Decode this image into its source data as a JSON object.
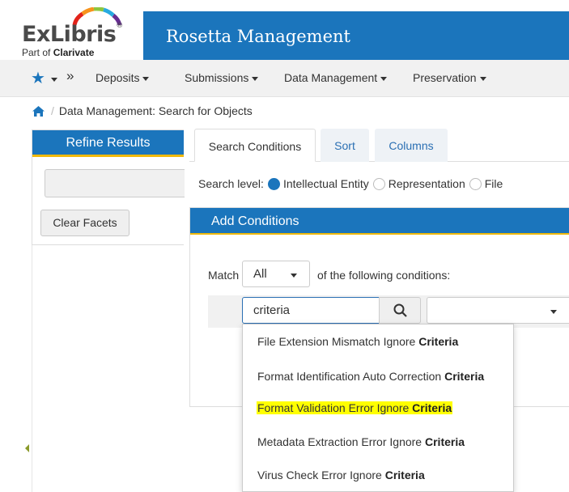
{
  "header": {
    "logo_name": "ExLibris",
    "logo_tagline_prefix": "Part of",
    "logo_tagline_brand": "Clarivate",
    "app_title": "Rosetta Management"
  },
  "nav": {
    "chevron": "»",
    "items": [
      "Deposits",
      "Submissions",
      "Data Management",
      "Preservation"
    ]
  },
  "breadcrumb": {
    "sep": "/",
    "text": "Data Management: Search for Objects"
  },
  "refine": {
    "title": "Refine Results",
    "clear_button": "Clear Facets"
  },
  "tabs": [
    "Search Conditions",
    "Sort",
    "Columns"
  ],
  "search_level": {
    "label": "Search level:",
    "options": [
      "Intellectual Entity",
      "Representation",
      "File"
    ],
    "selected": "Intellectual Entity"
  },
  "conditions": {
    "title": "Add Conditions",
    "match_label": "Match",
    "match_value": "All",
    "following_label": "of the following conditions:",
    "criteria_value": "criteria"
  },
  "dropdown": {
    "items": [
      {
        "prefix": "File Extension Mismatch Ignore ",
        "match": "Criteria",
        "highlighted": false
      },
      {
        "prefix": "Format Identification Auto Correction ",
        "match": "Criteria",
        "highlighted": false
      },
      {
        "prefix": "Format Validation Error Ignore ",
        "match": "Criteria",
        "highlighted": true
      },
      {
        "prefix": "Metadata Extraction Error Ignore ",
        "match": "Criteria",
        "highlighted": false
      },
      {
        "prefix": "Virus Check Error Ignore ",
        "match": "Criteria",
        "highlighted": false
      }
    ]
  },
  "colors": {
    "brand_blue": "#1b75bc",
    "accent_yellow": "#f0b90b",
    "highlight": "#ffff00"
  }
}
